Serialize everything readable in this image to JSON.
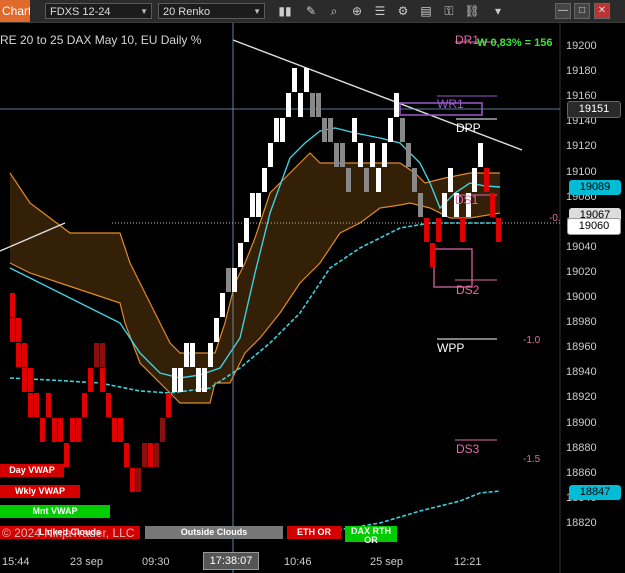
{
  "toolbar": {
    "chart_tab": "Chart",
    "instrument": "FDXS 12-24",
    "bar_type": "20 Renko",
    "icons": [
      "bar-chart-icon",
      "pencil-icon",
      "zoom-icon",
      "crosshair-icon",
      "properties-icon",
      "strategy-icon",
      "template-icon",
      "lock-icon",
      "more-icon"
    ]
  },
  "chart": {
    "title": "RE 20 to 25 DAX May 10, EU Daily %",
    "status_line": "W 0,83% = 156",
    "copyright": "© 2024 NinjaTrader, LLC",
    "crosshair_time": "17:38:07",
    "price_labels": [
      "19200",
      "19180",
      "19160",
      "19140",
      "19120",
      "19100",
      "19080",
      "19060",
      "19040",
      "19020",
      "19000",
      "18980",
      "18960",
      "18940",
      "18920",
      "18900",
      "18880",
      "18860",
      "18840",
      "18820"
    ],
    "time_labels": [
      "15:44",
      "23 sep",
      "09:30",
      "10:46",
      "25 sep",
      "12:21"
    ],
    "sigma_labels": [
      "-0.",
      "-1.0",
      "-1.5"
    ],
    "level_labels": {
      "dr1": "DR1",
      "wr1": "WR1",
      "dpp": "DPP",
      "ds1": "DS1",
      "ds2": "DS2",
      "wpp": "WPP",
      "ds3": "DS3"
    },
    "price_tags": [
      {
        "value": "19151",
        "bg": "#2a2a2a",
        "fg": "#ffffff"
      },
      {
        "value": "19089",
        "bg": "#00bcd4",
        "fg": "#000000"
      },
      {
        "value": "19067",
        "bg": "#dddddd",
        "fg": "#000000"
      },
      {
        "value": "19060",
        "bg": "#ffffff",
        "fg": "#000000"
      },
      {
        "value": "18847",
        "bg": "#00bcd4",
        "fg": "#000000"
      }
    ],
    "legend_buttons": {
      "day_vwap": "Day VWAP",
      "wkly_vwap": "Wkly VWAP",
      "mnt_vwap": "Mnt VWAP",
      "linked_clouds": "Linked Clouds",
      "outside_clouds": "Outside Clouds",
      "eth_or": "ETH OR",
      "dax_rth_or": "DAX RTH OR"
    }
  },
  "colors": {
    "bull_candle": "#ffffff",
    "bear_candle": "#e00000",
    "cloud_line": "#e08a2a",
    "vwap_line": "#3dd1e0",
    "green_accent": "#39e639",
    "pink_level": "#e66aa8"
  }
}
